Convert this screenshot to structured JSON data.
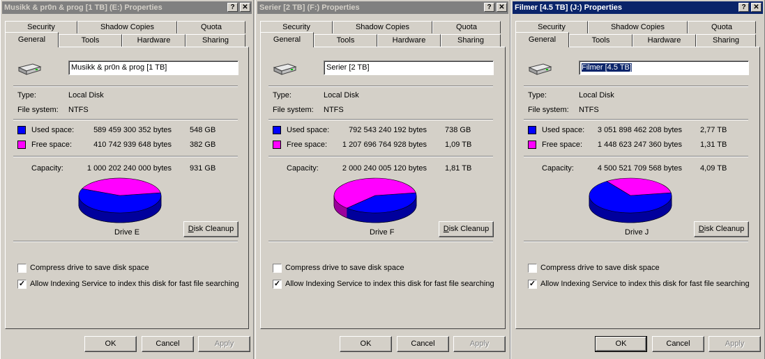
{
  "windows": [
    {
      "title": "Musikk & pr0n & prog [1 TB] (E:) Properties",
      "active": false,
      "name_value": "Musikk & pr0n & prog [1 TB]",
      "name_selected": false,
      "tabs_back": [
        "Security",
        "Shadow Copies",
        "Quota"
      ],
      "tabs_front": [
        "General",
        "Tools",
        "Hardware",
        "Sharing"
      ],
      "type_label": "Type:",
      "type_value": "Local Disk",
      "fs_label": "File system:",
      "fs_value": "NTFS",
      "used_label": "Used space:",
      "used_bytes": "589 459 300 352 bytes",
      "used_size": "548 GB",
      "free_label": "Free space:",
      "free_bytes": "410 742 939 648 bytes",
      "free_size": "382 GB",
      "capacity_label": "Capacity:",
      "capacity_bytes": "1 000 202 240 000 bytes",
      "capacity_size": "931 GB",
      "used_fraction": 0.589,
      "drive_label": "Drive E",
      "cleanup_label": "Disk Cleanup",
      "compress_label": "Compress drive to save disk space",
      "compress_checked": false,
      "index_label": "Allow Indexing Service to index this disk for fast file searching",
      "index_checked": true,
      "ok_label": "OK",
      "cancel_label": "Cancel",
      "apply_label": "Apply"
    },
    {
      "title": "Serier [2 TB] (F:) Properties",
      "active": false,
      "name_value": "Serier [2 TB]",
      "name_selected": false,
      "tabs_back": [
        "Security",
        "Shadow Copies",
        "Quota"
      ],
      "tabs_front": [
        "General",
        "Tools",
        "Hardware",
        "Sharing"
      ],
      "type_label": "Type:",
      "type_value": "Local Disk",
      "fs_label": "File system:",
      "fs_value": "NTFS",
      "used_label": "Used space:",
      "used_bytes": "792 543 240 192 bytes",
      "used_size": "738 GB",
      "free_label": "Free space:",
      "free_bytes": "1 207 696 764 928 bytes",
      "free_size": "1,09 TB",
      "capacity_label": "Capacity:",
      "capacity_bytes": "2 000 240 005 120 bytes",
      "capacity_size": "1,81 TB",
      "used_fraction": 0.396,
      "drive_label": "Drive F",
      "cleanup_label": "Disk Cleanup",
      "compress_label": "Compress drive to save disk space",
      "compress_checked": false,
      "index_label": "Allow Indexing Service to index this disk for fast file searching",
      "index_checked": true,
      "ok_label": "OK",
      "cancel_label": "Cancel",
      "apply_label": "Apply"
    },
    {
      "title": "Filmer [4.5 TB] (J:) Properties",
      "active": true,
      "name_value": "Filmer [4.5 TB]",
      "name_selected": true,
      "tabs_back": [
        "Security",
        "Shadow Copies",
        "Quota"
      ],
      "tabs_front": [
        "General",
        "Tools",
        "Hardware",
        "Sharing"
      ],
      "type_label": "Type:",
      "type_value": "Local Disk",
      "fs_label": "File system:",
      "fs_value": "NTFS",
      "used_label": "Used space:",
      "used_bytes": "3 051 898 462 208 bytes",
      "used_size": "2,77 TB",
      "free_label": "Free space:",
      "free_bytes": "1 448 623 247 360 bytes",
      "free_size": "1,31 TB",
      "capacity_label": "Capacity:",
      "capacity_bytes": "4 500 521 709 568 bytes",
      "capacity_size": "4,09 TB",
      "used_fraction": 0.678,
      "drive_label": "Drive J",
      "cleanup_label": "Disk Cleanup",
      "compress_label": "Compress drive to save disk space",
      "compress_checked": false,
      "index_label": "Allow Indexing Service to index this disk for fast file searching",
      "index_checked": true,
      "ok_label": "OK",
      "cancel_label": "Cancel",
      "apply_label": "Apply"
    }
  ],
  "colors": {
    "used": "#0000ff",
    "free": "#ff00ff",
    "used_dark": "#00009c",
    "free_dark": "#9c009c"
  },
  "icons": {
    "help": "help-icon",
    "close": "close-icon",
    "disk": "hard-disk-icon",
    "check": "checkmark-icon"
  }
}
